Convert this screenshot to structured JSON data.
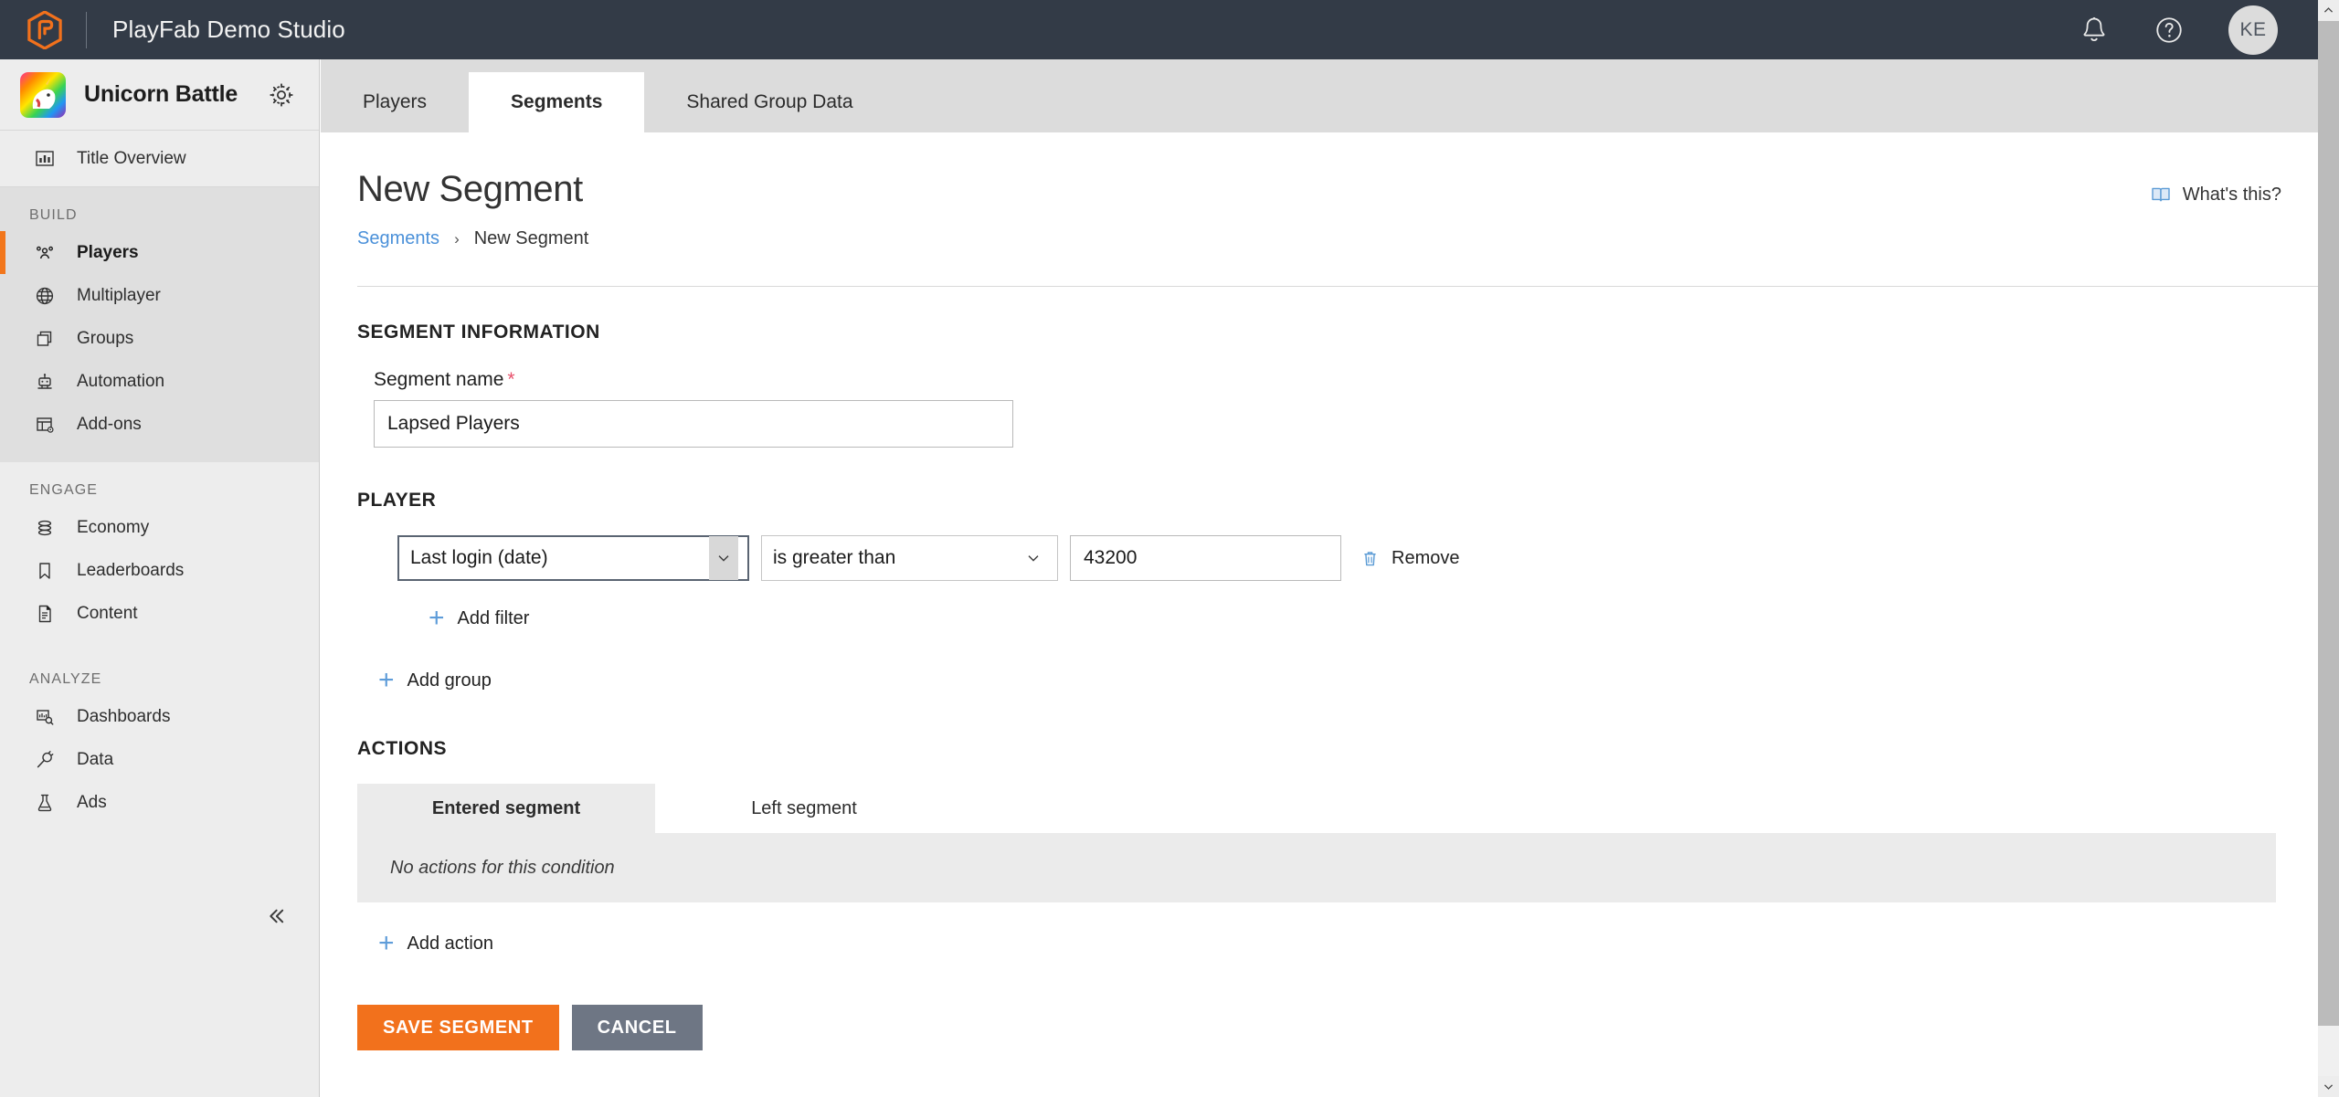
{
  "topbar": {
    "brand_title": "PlayFab Demo Studio",
    "logo_icon": "playfab-hexagon-logo",
    "notifications_icon": "bell-icon",
    "help_icon": "question-circle-icon",
    "avatar_initials": "KE",
    "accent_orange": "#f2711c",
    "bg": "#333b47"
  },
  "sidebar": {
    "title_name": "Unicorn Battle",
    "title_thumb_icon": "unicorn-title-thumbnail",
    "settings_icon": "gear-icon",
    "overview": {
      "label": "Title Overview",
      "icon": "bar-chart-icon"
    },
    "groups": [
      {
        "label": "BUILD",
        "shaded": true,
        "items": [
          {
            "label": "Players",
            "icon": "people-icon",
            "active": true
          },
          {
            "label": "Multiplayer",
            "icon": "globe-icon",
            "active": false
          },
          {
            "label": "Groups",
            "icon": "copy-stack-icon",
            "active": false
          },
          {
            "label": "Automation",
            "icon": "robot-icon",
            "active": false
          },
          {
            "label": "Add-ons",
            "icon": "table-gear-icon",
            "active": false
          }
        ]
      },
      {
        "label": "ENGAGE",
        "shaded": false,
        "items": [
          {
            "label": "Economy",
            "icon": "coins-stack-icon",
            "active": false
          },
          {
            "label": "Leaderboards",
            "icon": "bookmark-icon",
            "active": false
          },
          {
            "label": "Content",
            "icon": "document-icon",
            "active": false
          }
        ]
      },
      {
        "label": "ANALYZE",
        "shaded": false,
        "items": [
          {
            "label": "Dashboards",
            "icon": "dashboard-search-icon",
            "active": false
          },
          {
            "label": "Data",
            "icon": "plug-icon",
            "active": false
          },
          {
            "label": "Ads",
            "icon": "flask-icon",
            "active": false
          }
        ]
      }
    ],
    "collapse_icon": "chevron-double-left-icon"
  },
  "tabs": [
    {
      "label": "Players",
      "active": false
    },
    {
      "label": "Segments",
      "active": true
    },
    {
      "label": "Shared Group Data",
      "active": false
    }
  ],
  "page": {
    "title": "New Segment",
    "breadcrumb": {
      "parent": "Segments",
      "separator": "›",
      "current": "New Segment"
    },
    "whats_this": {
      "label": "What's this?",
      "icon": "book-icon"
    }
  },
  "segment_information": {
    "section_title": "SEGMENT INFORMATION",
    "name_label": "Segment name",
    "required_marker": "*",
    "name_value": "Lapsed Players",
    "name_placeholder": "Segment name"
  },
  "player_section": {
    "section_title": "PLAYER",
    "filter": {
      "field_value": "Last login (date)",
      "operator_value": "is greater than",
      "comparison_value": "43200",
      "comparison_placeholder": "",
      "remove_label": "Remove",
      "remove_icon": "trash-icon",
      "chevron_icon": "chevron-down-icon"
    },
    "add_filter_label": "Add filter",
    "add_group_label": "Add group",
    "plus_icon": "plus-icon"
  },
  "actions_section": {
    "section_title": "ACTIONS",
    "tabs": [
      {
        "label": "Entered segment",
        "active": true
      },
      {
        "label": "Left segment",
        "active": false
      }
    ],
    "empty_text": "No actions for this condition",
    "add_action_label": "Add action",
    "plus_icon": "plus-icon"
  },
  "footer_buttons": {
    "save_label": "SAVE SEGMENT",
    "cancel_label": "CANCEL",
    "save_color": "#f2711c",
    "cancel_color": "#6e7684"
  },
  "scrollbar": {
    "up_icon": "chevron-up-icon",
    "down_icon": "chevron-down-icon"
  }
}
